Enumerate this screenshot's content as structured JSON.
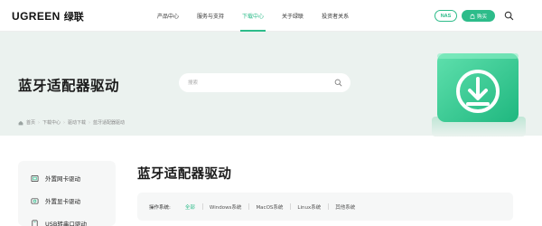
{
  "header": {
    "logo_en": "UGREEN",
    "logo_cn": "绿联",
    "nav": [
      {
        "label": "产品中心",
        "active": false
      },
      {
        "label": "服务与支持",
        "active": false
      },
      {
        "label": "下载中心",
        "active": true
      },
      {
        "label": "关于绿联",
        "active": false
      },
      {
        "label": "投资者关系",
        "active": false
      }
    ],
    "nas_label": "NAS",
    "buy_label": "购买"
  },
  "hero": {
    "title": "蓝牙适配器驱动",
    "search_placeholder": "搜索",
    "breadcrumb": [
      "首页",
      "下载中心",
      "驱动下载",
      "蓝牙适配器驱动"
    ]
  },
  "sidebar": {
    "items": [
      {
        "label": "外置网卡驱动"
      },
      {
        "label": "外置显卡驱动"
      },
      {
        "label": "USB转串口驱动"
      }
    ]
  },
  "main": {
    "title": "蓝牙适配器驱动",
    "filter_label": "操作系统:",
    "filters": [
      {
        "label": "全部",
        "active": true
      },
      {
        "label": "Windows系统",
        "active": false
      },
      {
        "label": "MacOS系统",
        "active": false
      },
      {
        "label": "Linux系统",
        "active": false
      },
      {
        "label": "其他系统",
        "active": false
      }
    ]
  },
  "colors": {
    "accent": "#2dbc8a",
    "hero_bg": "#ebf2ef"
  }
}
